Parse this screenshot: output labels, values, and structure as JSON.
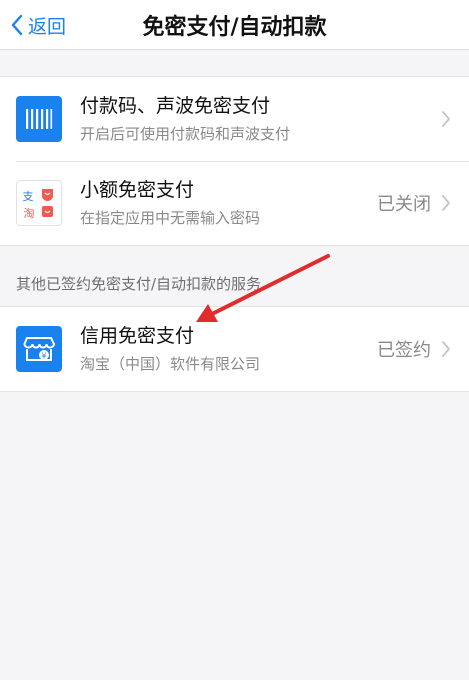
{
  "navbar": {
    "back_label": "返回",
    "title": "免密支付/自动扣款"
  },
  "top_group": [
    {
      "title": "付款码、声波免密支付",
      "subtitle": "开启后可使用付款码和声波支付",
      "status": "",
      "icon": "barcode-icon"
    },
    {
      "title": "小额免密支付",
      "subtitle": "在指定应用中无需输入密码",
      "status": "已关闭",
      "icon": "alipay-taobao-apps-icon",
      "icon_glyphs": [
        "支",
        "淘"
      ]
    }
  ],
  "section": {
    "label": "其他已签约免密支付/自动扣款的服务"
  },
  "services": [
    {
      "title": "信用免密支付",
      "subtitle": "淘宝（中国）软件有限公司",
      "status": "已签约",
      "icon": "credit-shop-icon",
      "icon_glyph": "¥"
    }
  ],
  "colors": {
    "accent": "#1a82ee",
    "arrow": "#e02c2c",
    "alipay_red": "#f05a4f"
  }
}
